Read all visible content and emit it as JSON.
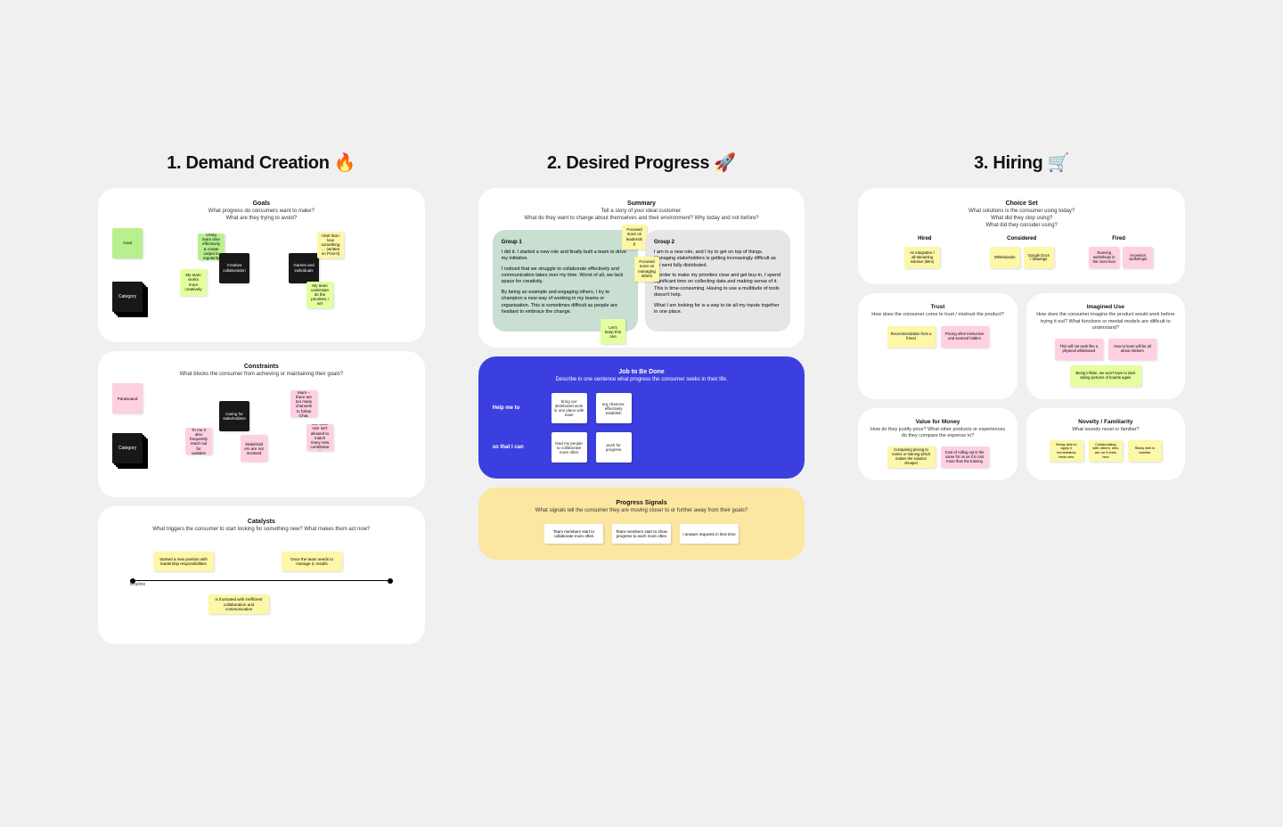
{
  "col1": {
    "title": "1. Demand Creation 🔥",
    "goals": {
      "h": "Goals",
      "sub": "What progress do consumers want to make?\nWhat are they trying to avoid?",
      "labels": {
        "goal": "Goal",
        "category": "Category"
      },
      "notes": {
        "g1": "Using team time effectively & create output in regularity",
        "g2": "My team works more creatively",
        "b1": "Creative collaboration",
        "b2": "Games and individuals",
        "y1": "I feel that I lose something… (written on Post-it)",
        "y2": "My team understands the priorities I set"
      }
    },
    "constraints": {
      "h": "Constraints",
      "sub": "What blocks the consumer from achieving or maintaining their goals?",
      "labels": {
        "pair": "Paraisoand",
        "category": "Category"
      },
      "notes": {
        "b1": "Caring for stakeholders",
        "p1": "To me it also frequently reach out for updates",
        "p2": "Stakeholders are not involved",
        "p3": "To my team – there are too many channels to follow (chat, email, etc.)",
        "p4": "Our team size isn't allowed to match many new contributors"
      }
    },
    "catalysts": {
      "h": "Catalysts",
      "sub": "What triggers the consumer to start looking for something new? What makes them act now?",
      "tl": "timeline",
      "n1": "Started a new position with leadership responsibilities",
      "n2": "Once the team needs to manage it, results",
      "n3": "is frustrated with inefficient collaboration and communication"
    }
  },
  "col2": {
    "title": "2. Desired Progress 🚀",
    "summary": {
      "h": "Summary",
      "sub": "Tell a story of your ideal customer.\nWhat do they want to change about themselves and their environment? Why today and not before?",
      "g1": {
        "title": "Group 1",
        "p1": "I did it. I started a new role and finally built a team to drive my initiative.",
        "p2": "I noticed that we struggle to collaborate effectively and communication takes over my time. Worst of all, we lack space for creativity.",
        "p3": "By being an example and engaging others, I try to champion a new way of working in my teams or organisation. This is sometimes difficult as people are hesitant to embrace the change.",
        "hang1": "Focused more on leadership",
        "hang2": "Let's keep this one"
      },
      "g2": {
        "title": "Group 2",
        "p1": "I am in a new role, and I try to get on top of things. Managing stakeholders is getting increasingly difficult as we went fully distributed.",
        "p2": "In order to make my priorities clear and get buy-in, I spend significant time on collecting data and making sense of it. This is time-consuming. Having to use a multitude of tools doesn't help.",
        "p3": "What I am looking for is a way to tie all my inputs together in one place.",
        "hang1": "Focused more on managing others"
      }
    },
    "jtbd": {
      "h": "Job to Be Done",
      "sub": "Describe in one sentence what progress the consumer seeks in their life.",
      "r1": {
        "label": "Help me to",
        "a": "bring our distributed work in one place with ease",
        "b": "org chances, effectively establish"
      },
      "r2": {
        "label": "so that I can",
        "a": "lead my people to collaborate more often",
        "b": "push for progress"
      }
    },
    "signals": {
      "h": "Progress Signals",
      "sub": "What signals tell the consumer they are moving closer to or further away from their goals?",
      "a": "Team members start to collaborate more often",
      "b": "Team members start to show progress to each more often",
      "c": "I answer requests in less time"
    }
  },
  "col3": {
    "title": "3. Hiring 🛒",
    "choice": {
      "h": "Choice Set",
      "sub": "What solutions is the consumer using today?\nWhat did they stop using?\nWhat did they consider using?",
      "heads": {
        "a": "Hired",
        "b": "Considered",
        "c": "Fired"
      },
      "hired": "An integrative / all-streaming solution (Miro)",
      "consA": "Whiteboards",
      "consB": "Google Docs / drawings",
      "firedA": "Running workshops in the room face",
      "firedB": "In-person workshops"
    },
    "trust": {
      "h": "Trust",
      "sub": "How does the consumer come to trust / mistrust the product?",
      "a": "Recommendation from a friend",
      "b": "Pricing often instructive and seemed hidden"
    },
    "imagined": {
      "h": "Imagined Use",
      "sub": "How does the consumer imagine the product would work before trying it out? What functions or mental models are difficult to understand?",
      "a": "This will not work like a physical whiteboard",
      "b": "How to learn will be all about stickers",
      "c": "Being infinite, we won't have to start taking pictures of boards again"
    },
    "value": {
      "h": "Value for Money",
      "sub": "How do they justify price? What other products or experiences do they compare the expense to?",
      "a": "Comparing pricing to rooms or training which makes the solution cheaper",
      "b": "Cost of rolling out is the same for us as if it cost more than the training"
    },
    "novelty": {
      "h": "Novelty / Familiarity",
      "sub": "What sounds novel or familiar?",
      "a": "Being able to apply it immediately feels new",
      "b": "Collaborating with others, who are on it feels new",
      "c": "Sticky-feel is familiar"
    }
  }
}
